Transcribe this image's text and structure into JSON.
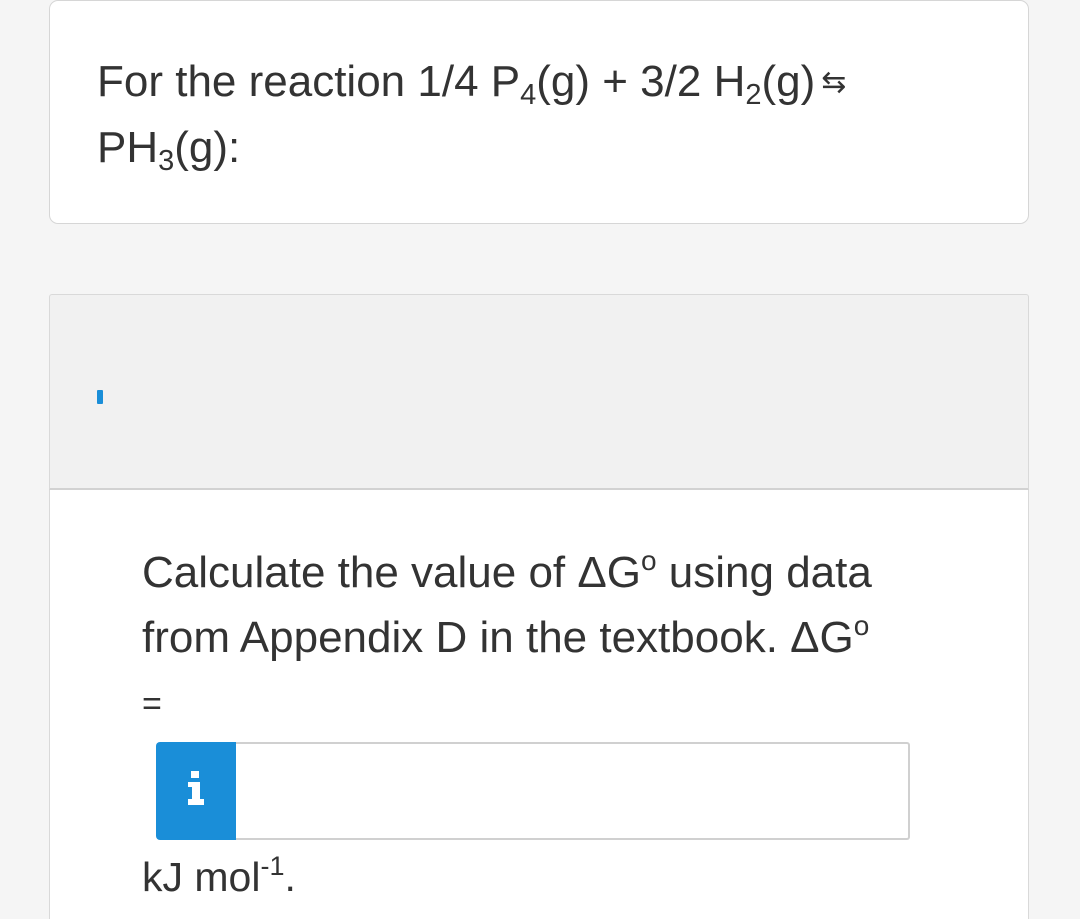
{
  "question": {
    "line1_prefix": "For the reaction 1/4 P",
    "p4_sub": "4",
    "h2_part": "(g) + 3/2 H",
    "h2_sub": "2",
    "g_part": "(g)",
    "arrow": "⇆",
    "line2_ph": "PH",
    "ph3_sub": "3",
    "line2_suffix": "(g):"
  },
  "prompt": {
    "part1": "Calculate the value of ΔG",
    "sup1": "o",
    "part2": " using data from Appendix D in the textbook. ΔG",
    "sup2": "o",
    "equals": "="
  },
  "answer": {
    "info_icon": "info-icon",
    "input_value": "",
    "input_placeholder": ""
  },
  "units": {
    "base": "kJ mol",
    "exponent": "-1",
    "suffix": "."
  },
  "colors": {
    "accent": "#1a8ed8",
    "text": "#333333",
    "band_bg": "#f1f1f1",
    "page_bg": "#f5f5f5"
  }
}
